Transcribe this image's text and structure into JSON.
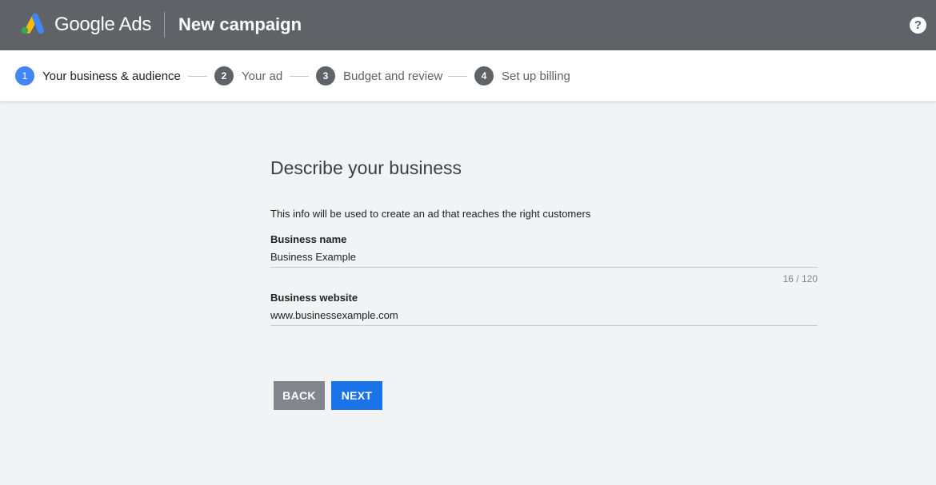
{
  "header": {
    "brand": "Google Ads",
    "page_title": "New campaign",
    "help_symbol": "?",
    "icons": [
      "google-ads-logo-icon",
      "help-icon"
    ],
    "background_color": "#5f6368"
  },
  "steps": [
    {
      "number": "1",
      "label": "Your business & audience",
      "active": true
    },
    {
      "number": "2",
      "label": "Your ad",
      "active": false
    },
    {
      "number": "3",
      "label": "Budget and review",
      "active": false
    },
    {
      "number": "4",
      "label": "Set up billing",
      "active": false
    }
  ],
  "form": {
    "title": "Describe your business",
    "description": "This info will be used to create an ad that reaches the right customers",
    "business_name": {
      "label": "Business name",
      "value": "Business Example",
      "counter": "16 / 120"
    },
    "business_website": {
      "label": "Business website",
      "value": "www.businessexample.com"
    }
  },
  "actions": {
    "back_label": "BACK",
    "next_label": "NEXT"
  },
  "colors": {
    "accent": "#1a73e8",
    "active_step": "#4285f4",
    "page_background": "#f1f3f4"
  }
}
